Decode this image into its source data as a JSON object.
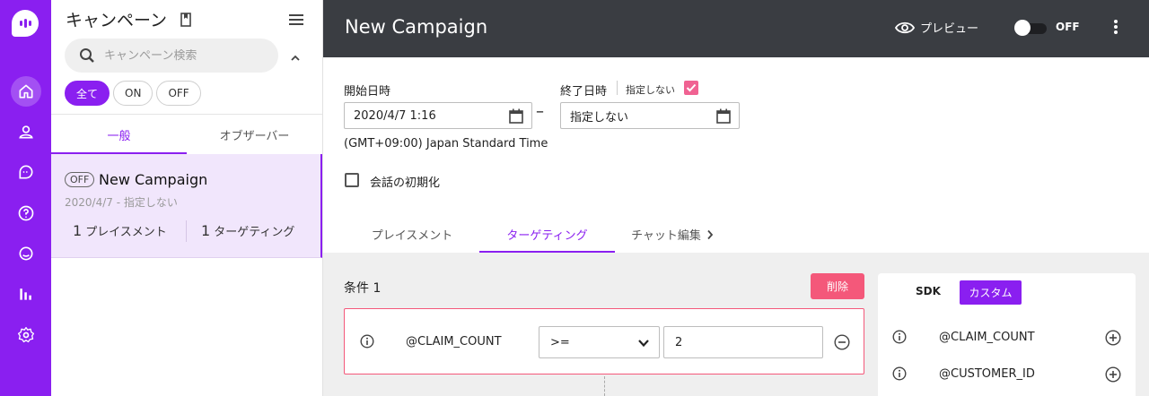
{
  "rail": {
    "nav": [
      "home-icon",
      "user-icon",
      "chat-icon",
      "help-icon",
      "conversation-icon",
      "analytics-icon",
      "settings-icon"
    ]
  },
  "list": {
    "title": "キャンペーン",
    "search_placeholder": "キャンペーン検索",
    "filters": [
      "全て",
      "ON",
      "OFF"
    ],
    "tabs": [
      "一般",
      "オブザーバー"
    ],
    "campaign": {
      "status": "OFF",
      "name": "New Campaign",
      "date": "2020/4/7 - 指定しない",
      "placement_count": "1",
      "placement_label": "プレイスメント",
      "targeting_count": "1",
      "targeting_label": "ターゲティング"
    }
  },
  "header": {
    "title": "New Campaign",
    "preview_label": "プレビュー",
    "toggle_label": "OFF"
  },
  "form": {
    "start_label": "開始日時",
    "start_value": "2020/4/7 1:16",
    "timezone": "(GMT+09:00) Japan Standard Time",
    "end_label": "終了日時",
    "end_unspecified_label": "指定しない",
    "end_unspecified_checked": true,
    "end_value": "指定しない",
    "reset_label": "会話の初期化",
    "reset_checked": false,
    "tabs": [
      "プレイスメント",
      "ターゲティング",
      "チャット編集"
    ]
  },
  "condition": {
    "title": "条件 1",
    "delete_label": "削除",
    "variable": "@CLAIM_COUNT",
    "operator": ">=",
    "value": "2"
  },
  "variables": {
    "tabs": [
      "SDK",
      "カスタム"
    ],
    "items": [
      "@CLAIM_COUNT",
      "@CUSTOMER_ID"
    ]
  },
  "colors": {
    "accent": "#8a1ff0",
    "danger": "#f4587a",
    "header": "#3a3d42"
  }
}
